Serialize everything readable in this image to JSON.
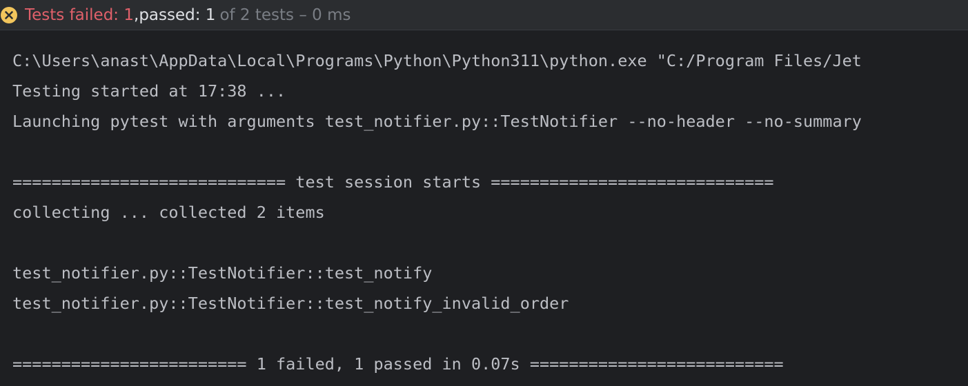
{
  "status": {
    "icon": "error-circle-icon",
    "failed_text": "Tests failed: 1",
    "separator": ",",
    "passed_text": " passed: 1",
    "total_text": "of 2 tests – 0 ms",
    "colors": {
      "failed": "#e0606a",
      "icon": "#f2c55c",
      "muted": "#7a7e85",
      "text": "#dfe1e5"
    }
  },
  "console": {
    "lines": [
      "C:\\Users\\anast\\AppData\\Local\\Programs\\Python\\Python311\\python.exe \"C:/Program Files/Jet",
      "Testing started at 17:38 ...",
      "Launching pytest with arguments test_notifier.py::TestNotifier --no-header --no-summary",
      "",
      "============================ test session starts =============================",
      "collecting ... collected 2 items",
      "",
      "test_notifier.py::TestNotifier::test_notify",
      "test_notifier.py::TestNotifier::test_notify_invalid_order",
      "",
      "======================== 1 failed, 1 passed in 0.07s =========================="
    ],
    "colors": {
      "background": "#1e1f22",
      "text": "#bcbec4"
    }
  }
}
